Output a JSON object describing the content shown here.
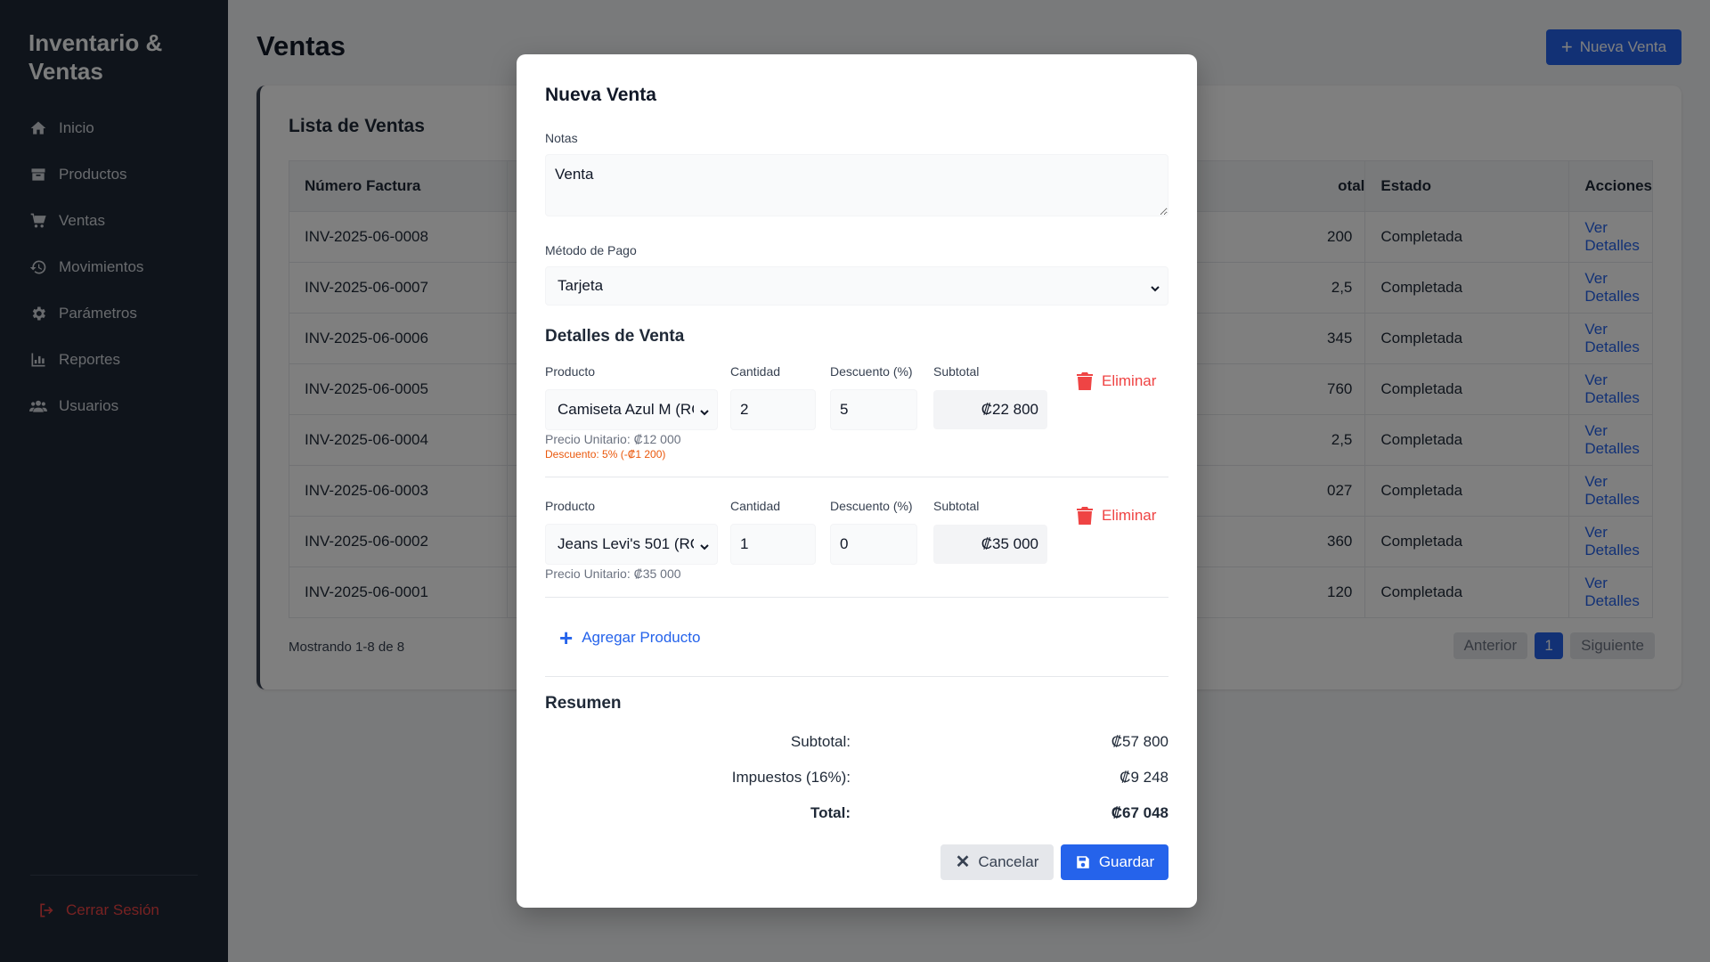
{
  "sidebar": {
    "brand": "Inventario & Ventas",
    "items": [
      {
        "label": "Inicio",
        "icon": "home-icon"
      },
      {
        "label": "Productos",
        "icon": "box-icon"
      },
      {
        "label": "Ventas",
        "icon": "cart-icon"
      },
      {
        "label": "Movimientos",
        "icon": "history-icon"
      },
      {
        "label": "Parámetros",
        "icon": "gear-icon"
      },
      {
        "label": "Reportes",
        "icon": "chart-icon"
      },
      {
        "label": "Usuarios",
        "icon": "users-icon"
      }
    ],
    "logout": "Cerrar Sesión"
  },
  "page": {
    "title": "Ventas",
    "new_button": "Nueva Venta",
    "list_title": "Lista de Ventas",
    "columns": [
      "Número Factura",
      "",
      "otal",
      "Estado",
      "Acciones"
    ],
    "rows": [
      {
        "invoice": "INV-2025-06-0008",
        "total": "200",
        "status": "Completada",
        "action": "Ver Detalles"
      },
      {
        "invoice": "INV-2025-06-0007",
        "total": "2,5",
        "status": "Completada",
        "action": "Ver Detalles"
      },
      {
        "invoice": "INV-2025-06-0006",
        "total": "345",
        "status": "Completada",
        "action": "Ver Detalles"
      },
      {
        "invoice": "INV-2025-06-0005",
        "total": "760",
        "status": "Completada",
        "action": "Ver Detalles"
      },
      {
        "invoice": "INV-2025-06-0004",
        "total": "2,5",
        "status": "Completada",
        "action": "Ver Detalles"
      },
      {
        "invoice": "INV-2025-06-0003",
        "total": "027",
        "status": "Completada",
        "action": "Ver Detalles"
      },
      {
        "invoice": "INV-2025-06-0002",
        "total": "360",
        "status": "Completada",
        "action": "Ver Detalles"
      },
      {
        "invoice": "INV-2025-06-0001",
        "total": "120",
        "status": "Completada",
        "action": "Ver Detalles"
      }
    ],
    "showing": "Mostrando 1-8 de 8",
    "pagination": {
      "prev": "Anterior",
      "current": "1",
      "next": "Siguiente"
    }
  },
  "modal": {
    "title": "Nueva Venta",
    "notes_label": "Notas",
    "notes_value": "Venta",
    "payment_label": "Método de Pago",
    "payment_value": "Tarjeta",
    "details_title": "Detalles de Venta",
    "labels": {
      "product": "Producto",
      "quantity": "Cantidad",
      "discount": "Descuento (%)",
      "subtotal": "Subtotal",
      "delete": "Eliminar"
    },
    "lines": [
      {
        "product": "Camiseta Azul M (RC",
        "quantity": "2",
        "discount": "5",
        "subtotal": "₡22 800",
        "unit_price": "Precio Unitario: ₡12 000",
        "discount_note": "Descuento: 5% (-₡1 200)"
      },
      {
        "product": "Jeans Levi's 501 (RC",
        "quantity": "1",
        "discount": "0",
        "subtotal": "₡35 000",
        "unit_price": "Precio Unitario: ₡35 000",
        "discount_note": ""
      }
    ],
    "add_product": "Agregar Producto",
    "summary": {
      "title": "Resumen",
      "subtotal_label": "Subtotal:",
      "subtotal_value": "₡57 800",
      "tax_label": "Impuestos (16%):",
      "tax_value": "₡9 248",
      "total_label": "Total:",
      "total_value": "₡67 048"
    },
    "cancel": "Cancelar",
    "save": "Guardar"
  }
}
